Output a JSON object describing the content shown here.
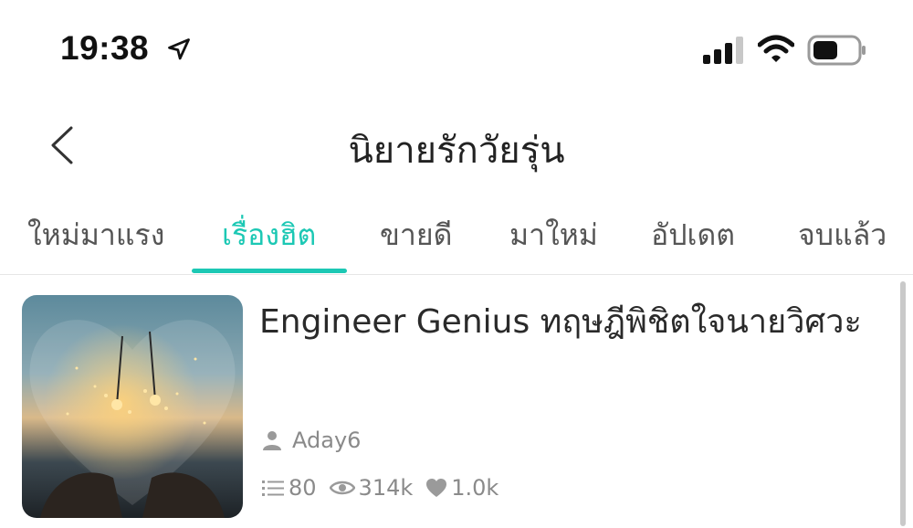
{
  "status_bar": {
    "time": "19:38",
    "icons": [
      "location-arrow-icon",
      "cellular-signal-icon",
      "wifi-icon",
      "battery-icon"
    ]
  },
  "nav": {
    "title": "นิยายรักวัยรุ่น",
    "back_icon": "chevron-left-icon"
  },
  "tabs": [
    {
      "label": "ใหม่มาแรง",
      "active": false
    },
    {
      "label": "เรื่องฮิต",
      "active": true
    },
    {
      "label": "ขายดี",
      "active": false
    },
    {
      "label": "มาใหม่",
      "active": false
    },
    {
      "label": "อัปเดต",
      "active": false
    },
    {
      "label": "จบแล้ว",
      "active": false
    }
  ],
  "stories": [
    {
      "title": "Engineer Genius ทฤษฎีพิชิตใจนายวิศวะ",
      "author": "Aday6",
      "chapters": "80",
      "views": "314k",
      "likes": "1.0k",
      "cover_image": "sparklers-heart-cover"
    }
  ],
  "colors": {
    "accent": "#1cc8b4",
    "muted_text": "#8a8a8a",
    "title_text": "#222222"
  }
}
